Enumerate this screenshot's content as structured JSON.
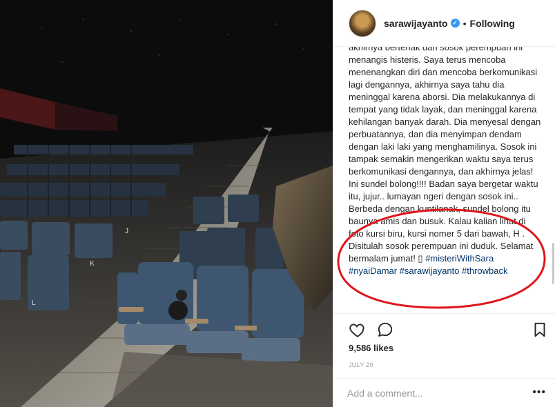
{
  "post": {
    "username": "sarawijayanto",
    "verified_mark": "✓",
    "separator": "•",
    "follow_status": "Following",
    "caption_text": "akhirnya berteriak dan sosok perempuan ini menangis histeris. Saya terus mencoba menenangkan diri dan mencoba berkomunikasi lagi dengannya, akhirnya saya tahu dia meninggal karena aborsi. Dia melakukannya di tempat yang tidak layak, dan meninggal karena kehilangan banyak darah. Dia menyesal dengan perbuatannya, dan dia menyimpan dendam dengan laki laki yang menghamilinya. Sosok ini tampak semakin mengerikan waktu saya terus berkomunikasi dengannya, dan akhirnya jelas! Ini sundel bolong!!!! Badan saya bergetar waktu itu, jujur.. lumayan ngeri dengan sosok ini.. Berbeda dengan kuntilanak, sundel bolong itu baunya amis dan busuk. Kalau kalian lihat di foto kursi biru, kursi nomer 5 dari bawah, H . Disitulah sosok perempuan ini duduk. Selamat bermalam jumat! ",
    "caption_tags": "#misteriWithSara #nyaiDamar #sarawijayanto #throwback",
    "emoji_box": "▯",
    "likes": "9,586 likes",
    "date": "JULY 20",
    "comment_placeholder": "Add a comment...",
    "more_label": "•••"
  },
  "icons": {
    "like": "heart-outline-icon",
    "comment": "speech-bubble-icon",
    "save": "bookmark-icon",
    "avatar": "profile-avatar"
  },
  "photo_labels": {
    "seat_j": "J",
    "seat_k": "K",
    "seat_l": "L"
  },
  "colors": {
    "accent_blue": "#3897f0",
    "annotation_red": "#e0151b",
    "seat_blue": "#3e5670"
  }
}
